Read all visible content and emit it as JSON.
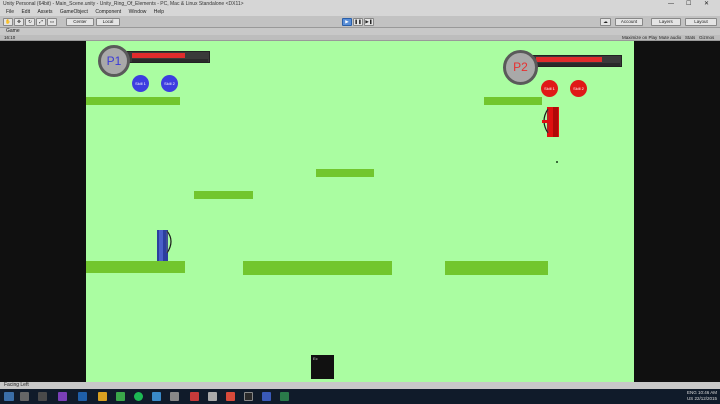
{
  "window": {
    "title": "Unity Personal (64bit) - Main_Scene.unity - Unity_Ring_Of_Elements - PC, Mac & Linux Standalone <DX11>",
    "controls": [
      "—",
      "☐",
      "✕"
    ]
  },
  "menu": [
    "File",
    "Edit",
    "Assets",
    "GameObject",
    "Component",
    "Window",
    "Help"
  ],
  "toolbar": {
    "center": "Center",
    "local": "Local",
    "account": "Account",
    "layers": "Layers",
    "layout": "Layout",
    "play_icon": "play-icon",
    "pause_icon": "pause-icon",
    "step_icon": "step-icon"
  },
  "game_view": {
    "tab": "Game",
    "aspect": "16:10",
    "options": [
      "Maximize on Play",
      "Mute audio",
      "Stats",
      "Gizmos"
    ]
  },
  "hud": {
    "p1": {
      "label": "P1",
      "skills": [
        "Skill 1",
        "Skill 2"
      ],
      "hp": 0.7
    },
    "p2": {
      "label": "P2",
      "skills": [
        "Skill 1",
        "Skill 2"
      ],
      "hp": 0.78
    }
  },
  "colors": {
    "background": "#aafda1",
    "platform": "#72c62e",
    "p1": "#2c3f9e",
    "p2": "#e01010"
  },
  "status": "Facing Left",
  "box_label": "Ec",
  "tray": {
    "lang1": "ENG",
    "lang2": "US",
    "time": "10:46 AM",
    "date": "22/12/2015"
  }
}
